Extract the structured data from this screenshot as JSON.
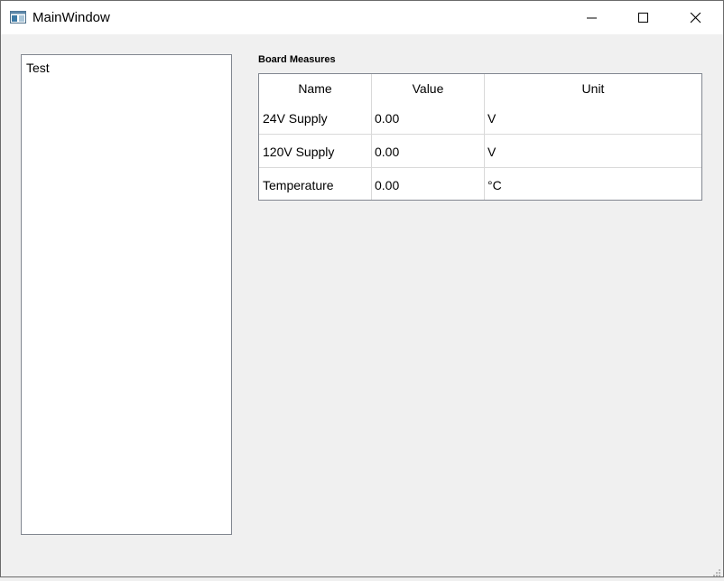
{
  "window": {
    "title": "MainWindow",
    "icons": {
      "app": "app-window-icon",
      "minimize": "minimize-icon",
      "maximize": "maximize-icon",
      "close": "close-icon"
    }
  },
  "list": {
    "items": [
      {
        "label": "Test"
      }
    ]
  },
  "board": {
    "title": "Board Measures",
    "columns": [
      "Name",
      "Value",
      "Unit"
    ],
    "rows": [
      {
        "name": "24V Supply",
        "value": "0.00",
        "unit": "V"
      },
      {
        "name": "120V Supply",
        "value": "0.00",
        "unit": "V"
      },
      {
        "name": "Temperature",
        "value": "0.00",
        "unit": "°C"
      }
    ]
  }
}
